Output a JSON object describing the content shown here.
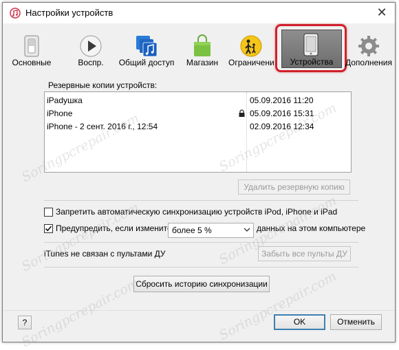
{
  "window": {
    "title": "Настройки устройств"
  },
  "toolbar": {
    "items": [
      {
        "label": "Основные"
      },
      {
        "label": "Воспр."
      },
      {
        "label": "Общий доступ"
      },
      {
        "label": "Магазин"
      },
      {
        "label": "Ограничени"
      },
      {
        "label": "Устройства"
      },
      {
        "label": "Дополнения"
      }
    ],
    "selected": "Устройства"
  },
  "backups": {
    "label": "Резервные копии устройств:",
    "rows": [
      {
        "name": "iPadушка",
        "date": "05.09.2016 11:20",
        "locked": false
      },
      {
        "name": "iPhone",
        "date": "05.09.2016 15:31",
        "locked": true
      },
      {
        "name": "iPhone - 2 сент. 2016 г., 12:54",
        "date": "02.09.2016 12:34",
        "locked": false
      }
    ],
    "delete_label": "Удалить резервную копию"
  },
  "options": {
    "prevent_sync_label": "Запретить автоматическую синхронизацию устройств iPod, iPhone и iPad",
    "prevent_sync_checked": false,
    "warn_label_prefix": "Предупредить, если изменится",
    "warn_checked": true,
    "warn_select_value": "более 5 %",
    "warn_label_suffix": "данных на этом компьютере"
  },
  "remote": {
    "status": "iTunes не связан с пультами ДУ",
    "forget_label": "Забыть все пульты ДУ"
  },
  "reset_sync_label": "Сбросить историю синхронизации",
  "footer": {
    "help_label": "?",
    "ok_label": "OK",
    "cancel_label": "Отменить"
  },
  "watermark_text": "Soringpcrepair.com",
  "colors": {
    "highlight": "#d0202a",
    "selected_bg": "#7a7a7a"
  }
}
